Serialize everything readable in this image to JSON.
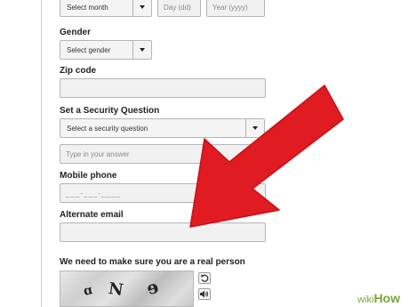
{
  "birthday": {
    "month_select": "Select month",
    "day_placeholder": "Day (dd)",
    "year_placeholder": "Year (yyyy)"
  },
  "gender": {
    "label": "Gender",
    "select_value": "Select gender"
  },
  "zip": {
    "label": "Zip code",
    "value": ""
  },
  "security": {
    "label": "Set a Security Question",
    "select_value": "Select a security question",
    "answer_placeholder": "Type in your answer"
  },
  "mobile": {
    "label": "Mobile phone",
    "placeholder": "___-___-____"
  },
  "alt_email": {
    "label": "Alternate email",
    "value": ""
  },
  "captcha": {
    "heading": "We need to make sure you are a real person",
    "refresh_icon": "refresh-icon",
    "audio_icon": "speaker-icon"
  },
  "annotation": {
    "arrow_color": "#e01b22"
  },
  "watermark": {
    "part1": "wiki",
    "part2": "How"
  }
}
